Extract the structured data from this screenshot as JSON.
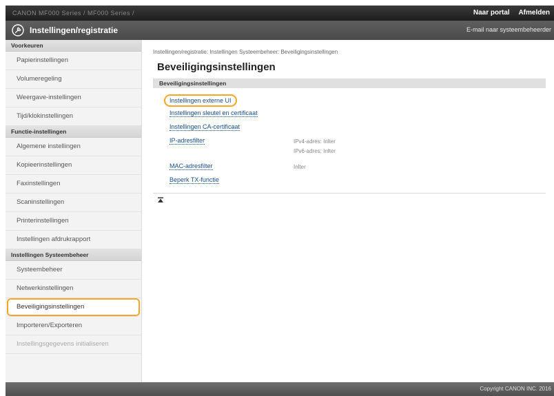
{
  "topbar": {
    "device_name": "CANON  MF000 Series / MF000 Series /",
    "portal_link": "Naar portal",
    "logout_link": "Afmelden"
  },
  "header": {
    "title": "Instellingen/registratie",
    "email_link": "E-mail naar systeembeheerder"
  },
  "sidebar": {
    "sections": [
      {
        "heading": "Voorkeuren",
        "items": [
          {
            "label": "Papierinstellingen"
          },
          {
            "label": "Volumeregeling"
          },
          {
            "label": "Weergave-instellingen"
          },
          {
            "label": "Tijd/klokinstellingen"
          }
        ]
      },
      {
        "heading": "Functie-instellingen",
        "items": [
          {
            "label": "Algemene instellingen"
          },
          {
            "label": "Kopieerinstellingen"
          },
          {
            "label": "Faxinstellingen"
          },
          {
            "label": "Scaninstellingen"
          },
          {
            "label": "Printerinstellingen"
          },
          {
            "label": "Instellingen afdrukrapport"
          }
        ]
      },
      {
        "heading": "Instellingen Systeembeheer",
        "items": [
          {
            "label": "Systeembeheer"
          },
          {
            "label": "Netwerkinstellingen"
          },
          {
            "label": "Beveiligingsinstellingen"
          },
          {
            "label": "Importeren/Exporteren"
          },
          {
            "label": "Instellingsgegevens initialiseren"
          }
        ]
      }
    ]
  },
  "main": {
    "breadcrumb": "Instellingen/registratie: Instellingen Systeembeheer: Beveiligingsinstellingen",
    "title": "Beveiligingsinstellingen",
    "section_header": "Beveiligingsinstellingen",
    "links": [
      {
        "label": "Instellingen externe UI"
      },
      {
        "label": "Instellingen sleutel en certificaat"
      },
      {
        "label": "Instellingen CA-certificaat"
      },
      {
        "label": "IP-adresfilter",
        "values": [
          "IPv4-adres: Inlter",
          "IPv6-adres: Inlter"
        ]
      },
      {
        "label": "MAC-adresfilter",
        "values": [
          "Inlter"
        ]
      },
      {
        "label": "Beperk TX-functie"
      }
    ]
  },
  "footer": {
    "copyright": "Copyright CANON INC. 2016"
  },
  "colors": {
    "highlight": "#f5a623",
    "link": "#1a4f8a",
    "header_bg": "#4a4a4a"
  }
}
